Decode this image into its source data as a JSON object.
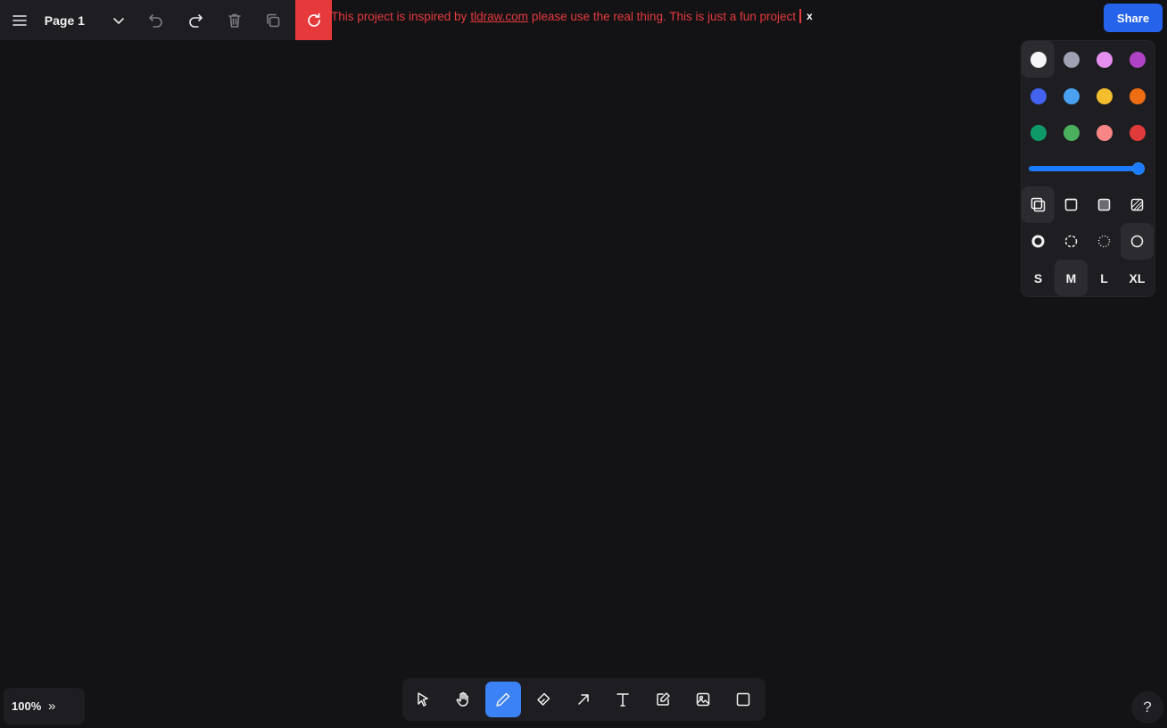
{
  "top_panel": {
    "page_name": "Page 1"
  },
  "banner": {
    "prefix": "This project is inspired by",
    "link": "tldraw.com",
    "suffix": "please use the real thing. This is just a fun project",
    "close": "x"
  },
  "share": {
    "label": "Share"
  },
  "style_panel": {
    "colors": [
      {
        "name": "white",
        "hex": "#f5f5f7"
      },
      {
        "name": "grey",
        "hex": "#9ea2b3"
      },
      {
        "name": "light-violet",
        "hex": "#e58ff0"
      },
      {
        "name": "violet",
        "hex": "#b042c6"
      },
      {
        "name": "blue",
        "hex": "#4262ef"
      },
      {
        "name": "light-blue",
        "hex": "#4ba1f1"
      },
      {
        "name": "yellow",
        "hex": "#f3bd2e"
      },
      {
        "name": "orange",
        "hex": "#ee6d12"
      },
      {
        "name": "green",
        "hex": "#0f9968"
      },
      {
        "name": "light-green",
        "hex": "#4bb05e"
      },
      {
        "name": "light-red",
        "hex": "#f88686"
      },
      {
        "name": "red",
        "hex": "#e13a3a"
      }
    ],
    "selected_color": "white",
    "opacity": 1.0,
    "fill_options": [
      "none",
      "semi",
      "solid",
      "pattern"
    ],
    "dash_options": [
      "draw",
      "dashed",
      "dotted",
      "solid"
    ],
    "size_options": [
      "S",
      "M",
      "L",
      "XL"
    ],
    "selected_size": "M"
  },
  "toolbar": {
    "tools": [
      "select",
      "hand",
      "draw",
      "eraser",
      "arrow",
      "text",
      "note",
      "image",
      "rectangle"
    ],
    "active_tool": "draw",
    "text_glyph": "T"
  },
  "zoom": {
    "level": "100%",
    "expand": "»"
  },
  "help": {
    "label": "?"
  },
  "colors": {
    "canvas": "#131316",
    "panel": "#1e1e22",
    "accent_blue": "#3b82f6",
    "share_blue": "#2563eb",
    "banner_red": "#e5393c"
  }
}
